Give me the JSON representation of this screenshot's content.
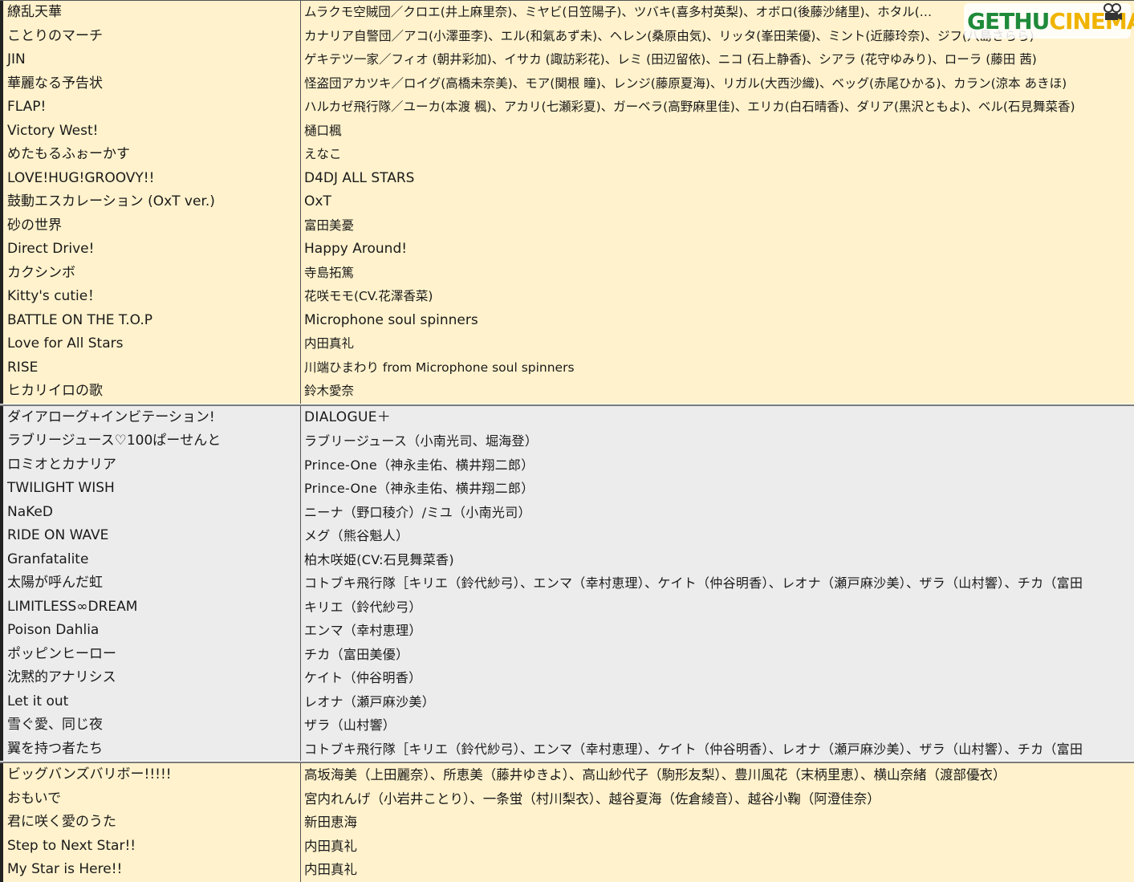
{
  "groups": [
    {
      "rows": [
        {
          "title": "繚乱天華",
          "artist": "ムラクモ空賊団／クロエ(井上麻里奈)、ミヤビ(日笠陽子)、ツバキ(喜多村英梨)、オボロ(後藤沙緒里)、ホタル(…"
        },
        {
          "title": "ことりのマーチ",
          "artist": "カナリア自警団／アコ(小澤亜李)、エル(和氣あず未)、ヘレン(桑原由気)、リッタ(峯田茉優)、ミント(近藤玲奈)、ジフ(八島さらら)"
        },
        {
          "title": "JIN",
          "artist": "ゲキテツ一家／フィオ (朝井彩加)、イサカ (諏訪彩花)、レミ (田辺留依)、ニコ (石上静香)、シアラ (花守ゆみり)、ローラ (藤田 茜)"
        },
        {
          "title": "華麗なる予告状",
          "artist": "怪盗団アカツキ／ロイグ(高橋未奈美)、モア(関根 瞳)、レンジ(藤原夏海)、リガル(大西沙織)、ベッグ(赤尾ひかる)、カラン(涼本 あきほ)"
        },
        {
          "title": "FLAP!",
          "artist": "ハルカゼ飛行隊／ユーカ(本渡 楓)、アカリ(七瀬彩夏)、ガーベラ(高野麻里佳)、エリカ(白石晴香)、ダリア(黒沢ともよ)、ベル(石見舞菜香)"
        },
        {
          "title": "Victory West!",
          "artist": "樋口楓"
        },
        {
          "title": "めたもるふぉーかす",
          "artist": "えなこ"
        },
        {
          "title": "LOVE!HUG!GROOVY!!",
          "artist": "D4DJ ALL STARS"
        },
        {
          "title": "鼓動エスカレーション (OxT ver.)",
          "artist": "OxT"
        },
        {
          "title": "砂の世界",
          "artist": "富田美憂"
        },
        {
          "title": "Direct Drive!",
          "artist": "Happy Around!"
        },
        {
          "title": "カクシンボ",
          "artist": "寺島拓篤"
        },
        {
          "title": "Kitty's cutie！",
          "artist": "花咲モモ(CV.花澤香菜)"
        },
        {
          "title": "BATTLE ON THE T.O.P",
          "artist": "Microphone soul spinners"
        },
        {
          "title": "Love for All Stars",
          "artist": "内田真礼"
        },
        {
          "title": "RISE",
          "artist": "川端ひまわり from Microphone soul spinners"
        },
        {
          "title": "ヒカリイロの歌",
          "artist": "鈴木愛奈"
        }
      ]
    },
    {
      "rows": [
        {
          "title": "ダイアローグ+インビテーション!",
          "artist": "DIALOGUE＋"
        },
        {
          "title": "ラブリージュース♡100ぱーせんと",
          "artist": "ラブリージュース（小南光司、堀海登）"
        },
        {
          "title": "ロミオとカナリア",
          "artist": "Prince-One（神永圭佑、横井翔二郎）"
        },
        {
          "title": "TWILIGHT WISH",
          "artist": "Prince-One（神永圭佑、横井翔二郎）"
        },
        {
          "title": "NaKeD",
          "artist": "ニーナ（野口稜介）/ミユ（小南光司）"
        },
        {
          "title": "RIDE ON WAVE",
          "artist": "メグ（熊谷魁人）"
        },
        {
          "title": "Granfatalite",
          "artist": "柏木咲姫(CV:石見舞菜香)"
        },
        {
          "title": "太陽が呼んだ虹",
          "artist": "コトブキ飛行隊［キリエ（鈴代紗弓）、エンマ（幸村恵理）、ケイト（仲谷明香）、レオナ（瀬戸麻沙美）、ザラ（山村響）、チカ（富田"
        },
        {
          "title": "LIMITLESS∞DREAM",
          "artist": "キリエ（鈴代紗弓）"
        },
        {
          "title": "Poison Dahlia",
          "artist": "エンマ（幸村恵理）"
        },
        {
          "title": "ポッピンヒーロー",
          "artist": "チカ（富田美優）"
        },
        {
          "title": "沈黙的アナリシス",
          "artist": "ケイト（仲谷明香）"
        },
        {
          "title": "Let it out",
          "artist": "レオナ（瀬戸麻沙美）"
        },
        {
          "title": "雪ぐ愛、同じ夜",
          "artist": "ザラ（山村響）"
        },
        {
          "title": "翼を持つ者たち",
          "artist": "コトブキ飛行隊［キリエ（鈴代紗弓）、エンマ（幸村恵理）、ケイト（仲谷明香）、レオナ（瀬戸麻沙美）、ザラ（山村響）、チカ（富田"
        }
      ]
    },
    {
      "rows": [
        {
          "title": "ビッグバンズバリボー!!!!!",
          "artist": "高坂海美（上田麗奈）、所恵美（藤井ゆきよ）、高山紗代子（駒形友梨）、豊川風花（末柄里恵）、横山奈緒（渡部優衣）"
        },
        {
          "title": "おもいで",
          "artist": "宮内れんげ（小岩井ことり）、一条蛍（村川梨衣）、越谷夏海（佐倉綾音）、越谷小鞠（阿澄佳奈）"
        },
        {
          "title": "君に咲く愛のうた",
          "artist": "新田恵海"
        },
        {
          "title": "Step to Next Star!!",
          "artist": "内田真礼"
        },
        {
          "title": "My Star is Here!!",
          "artist": "内田真礼"
        }
      ]
    }
  ],
  "watermark": {
    "part1": "GETHU",
    "part2": "CINEMA"
  },
  "colors": {
    "group_yellow": "#fff2cc",
    "group_gray": "#ececec"
  }
}
